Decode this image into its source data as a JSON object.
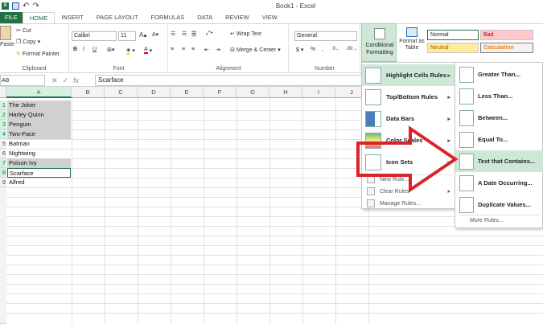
{
  "app": {
    "window_title": "Book1 - Excel",
    "qat": {
      "excel_icon": "X"
    }
  },
  "tabs": [
    "FILE",
    "HOME",
    "INSERT",
    "PAGE LAYOUT",
    "FORMULAS",
    "DATA",
    "REVIEW",
    "VIEW"
  ],
  "ribbon": {
    "clipboard": {
      "label": "Clipboard",
      "paste": "Paste",
      "cut": "Cut",
      "copy": "Copy",
      "format_painter": "Format Painter"
    },
    "font": {
      "label": "Font",
      "font_name": "Calibri",
      "font_size": "11",
      "bold": "B",
      "italic": "I",
      "underline": "U"
    },
    "alignment": {
      "label": "Alignment",
      "wrap_text": "Wrap Text",
      "merge_center": "Merge & Center"
    },
    "number": {
      "label": "Number",
      "format": "General",
      "currency": "$",
      "percent": "%",
      "comma": ","
    },
    "styles": {
      "conditional_formatting": "Conditional Formatting",
      "format_as_table": "Format as Table",
      "normal": "Normal",
      "bad": "Bad",
      "neutral": "Neutral",
      "calculation": "Calculation"
    }
  },
  "formula_bar": {
    "name_box": "A8",
    "fx": "fx",
    "value": "Scarface"
  },
  "columns": [
    "A",
    "B",
    "C",
    "D",
    "E",
    "F",
    "G",
    "H",
    "I",
    "J"
  ],
  "rows": [
    "1",
    "2",
    "3",
    "4",
    "5",
    "6",
    "7",
    "8",
    "9"
  ],
  "cells_a": [
    "The Joker",
    "Harley Quinn",
    "Penguin",
    "Two-Face",
    "Batman",
    "Nightwing",
    "Poison Ivy",
    "Scarface",
    "Alfred"
  ],
  "cf_menu": {
    "items": [
      "Highlight Cells Rules",
      "Top/Bottom Rules",
      "Data Bars",
      "Color Scales",
      "Icon Sets"
    ],
    "small_items": [
      "New Rule...",
      "Clear Rules",
      "Manage Rules..."
    ]
  },
  "highlight_submenu": {
    "items": [
      "Greater Than...",
      "Less Than...",
      "Between...",
      "Equal To...",
      "Text that Contains...",
      "A Date Occurring...",
      "Duplicate Values..."
    ],
    "more": "More Rules..."
  },
  "colors": {
    "excel_green": "#217346",
    "menu_hover": "#cfe7d6",
    "red_arrow": "#d9252a",
    "selection_gray": "#d0d0d0"
  }
}
